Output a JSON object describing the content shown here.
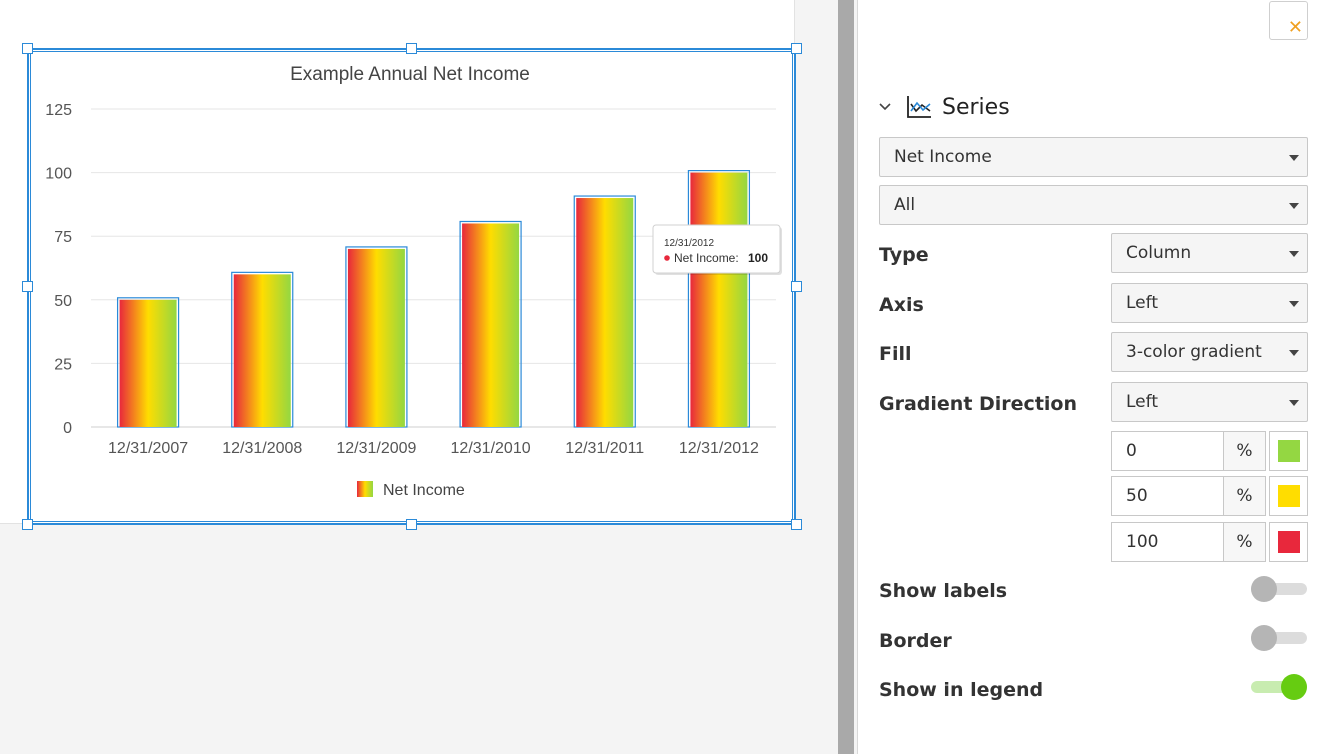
{
  "chart_data": {
    "type": "bar",
    "title": "Example Annual Net Income",
    "categories": [
      "12/31/2007",
      "12/31/2008",
      "12/31/2009",
      "12/31/2010",
      "12/31/2011",
      "12/31/2012"
    ],
    "series": [
      {
        "name": "Net Income",
        "values": [
          50,
          60,
          70,
          80,
          90,
          100
        ]
      }
    ],
    "ylim": [
      0,
      125
    ],
    "yticks": [
      "0",
      "25",
      "50",
      "75",
      "100",
      "125"
    ],
    "grid": true,
    "legend": "bottom",
    "fill": "3-color gradient",
    "gradient_colors": [
      "#e8283c",
      "#ffdd00",
      "#94d742"
    ],
    "tooltip": {
      "category": "12/31/2012",
      "label": "Net Income:",
      "value": "100",
      "dot_color": "#e8283c"
    }
  },
  "panel": {
    "close_icon": "close-icon",
    "section_title": "Series",
    "series_select": "Net Income",
    "scope_select": "All",
    "type_label": "Type",
    "type_value": "Column",
    "axis_label": "Axis",
    "axis_value": "Left",
    "fill_label": "Fill",
    "fill_value": "3-color gradient",
    "gradient_direction_label": "Gradient Direction",
    "gradient_direction_value": "Left",
    "stops": [
      {
        "value": "0",
        "unit": "%",
        "color": "#94d742"
      },
      {
        "value": "50",
        "unit": "%",
        "color": "#ffdd00"
      },
      {
        "value": "100",
        "unit": "%",
        "color": "#e8283c"
      }
    ],
    "show_labels_label": "Show labels",
    "show_labels_on": false,
    "border_label": "Border",
    "border_on": false,
    "show_in_legend_label": "Show in legend",
    "show_in_legend_on": true,
    "toggle_on_color": "#66cc11"
  }
}
